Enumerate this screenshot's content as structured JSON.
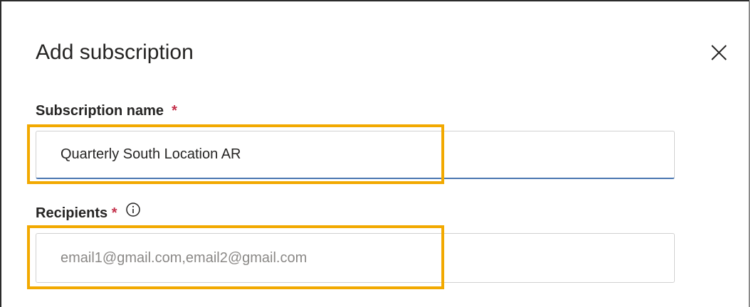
{
  "dialog": {
    "title": "Add subscription",
    "close_icon": "close-icon"
  },
  "fields": {
    "subscription_name": {
      "label": "Subscription name",
      "required_marker": "*",
      "value": "Quarterly South Location AR"
    },
    "recipients": {
      "label": "Recipients",
      "required_marker": "*",
      "info_icon": "info-icon",
      "value": "",
      "placeholder": "email1@gmail.com,email2@gmail.com"
    }
  },
  "colors": {
    "required": "#c4314b",
    "highlight": "#f2a900",
    "input_focus_border": "#4a76b0"
  }
}
